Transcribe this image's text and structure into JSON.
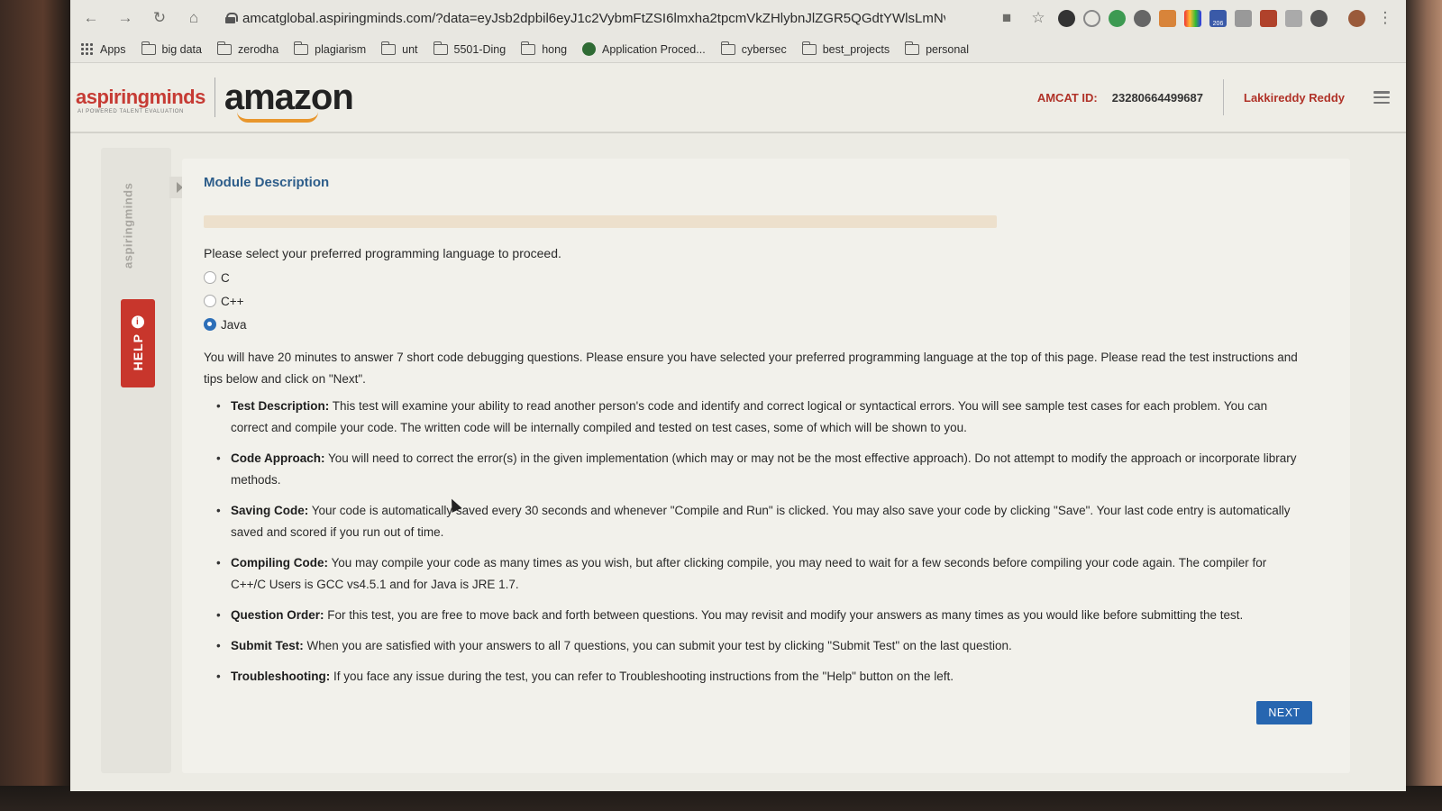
{
  "browser": {
    "url": "amcatglobal.aspiringminds.com/?data=eyJsb2dpbil6eyJ1c2VybmFtZSI6lmxha2tpcmVkZHlybnJlZGR5QGdtYWlsLmNv...",
    "bookmarks": [
      "Apps",
      "big data",
      "zerodha",
      "plagiarism",
      "unt",
      "5501-Ding",
      "hong",
      "Application Proced...",
      "cybersec",
      "best_projects",
      "personal"
    ],
    "extension_badge": "206"
  },
  "header": {
    "logo_aspiring": "aspiringminds",
    "logo_aspiring_sub": "AI POWERED TALENT EVALUATION",
    "logo_amazon": "amazon",
    "amcat_label": "AMCAT ID:",
    "amcat_id": "23280664499687",
    "user_name": "Lakkireddy Reddy"
  },
  "side": {
    "brand": "aspiringminds",
    "help_label": "HELP"
  },
  "main": {
    "title": "Module Description",
    "progress": 0.0,
    "prompt": "Please select your preferred programming language to proceed.",
    "languages": [
      "C",
      "C++",
      "Java"
    ],
    "selected_language": "Java",
    "intro": "You will have 20 minutes to answer 7 short code debugging questions. Please ensure you have selected your preferred programming language at the top of this page. Please read the test instructions and tips below and click on \"Next\".",
    "tips": [
      {
        "title": "Test Description:",
        "text": " This test will examine your ability to read another person's code and identify and correct logical or syntactical errors. You will see sample test cases for each problem. You can correct and compile your code. The written code will be internally compiled and tested on test cases, some of which will be shown to you."
      },
      {
        "title": "Code Approach:",
        "text": " You will need to correct the error(s) in the given implementation (which may or may not be the most effective approach). Do not attempt to modify the approach or incorporate library methods."
      },
      {
        "title": "Saving Code:",
        "text": " Your code is automatically saved every 30 seconds and whenever \"Compile and Run\" is clicked. You may also save your code by clicking \"Save\". Your last code entry is automatically saved and scored if you run out of time."
      },
      {
        "title": "Compiling Code:",
        "text": " You may compile your code as many times as you wish, but after clicking compile, you may need to wait for a few seconds before compiling your code again. The compiler for C++/C Users is GCC vs4.5.1 and for Java is JRE 1.7."
      },
      {
        "title": "Question Order:",
        "text": " For this test, you are free to move back and forth between questions. You may revisit and modify your answers as many times as you would like before submitting the test."
      },
      {
        "title": "Submit Test:",
        "text": " When you are satisfied with your answers to all 7 questions, you can submit your test by clicking \"Submit Test\" on the last question."
      },
      {
        "title": "Troubleshooting:",
        "text": " If you face any issue during the test, you can refer to Troubleshooting instructions from the \"Help\" button on the left."
      }
    ],
    "next_label": "NEXT"
  }
}
